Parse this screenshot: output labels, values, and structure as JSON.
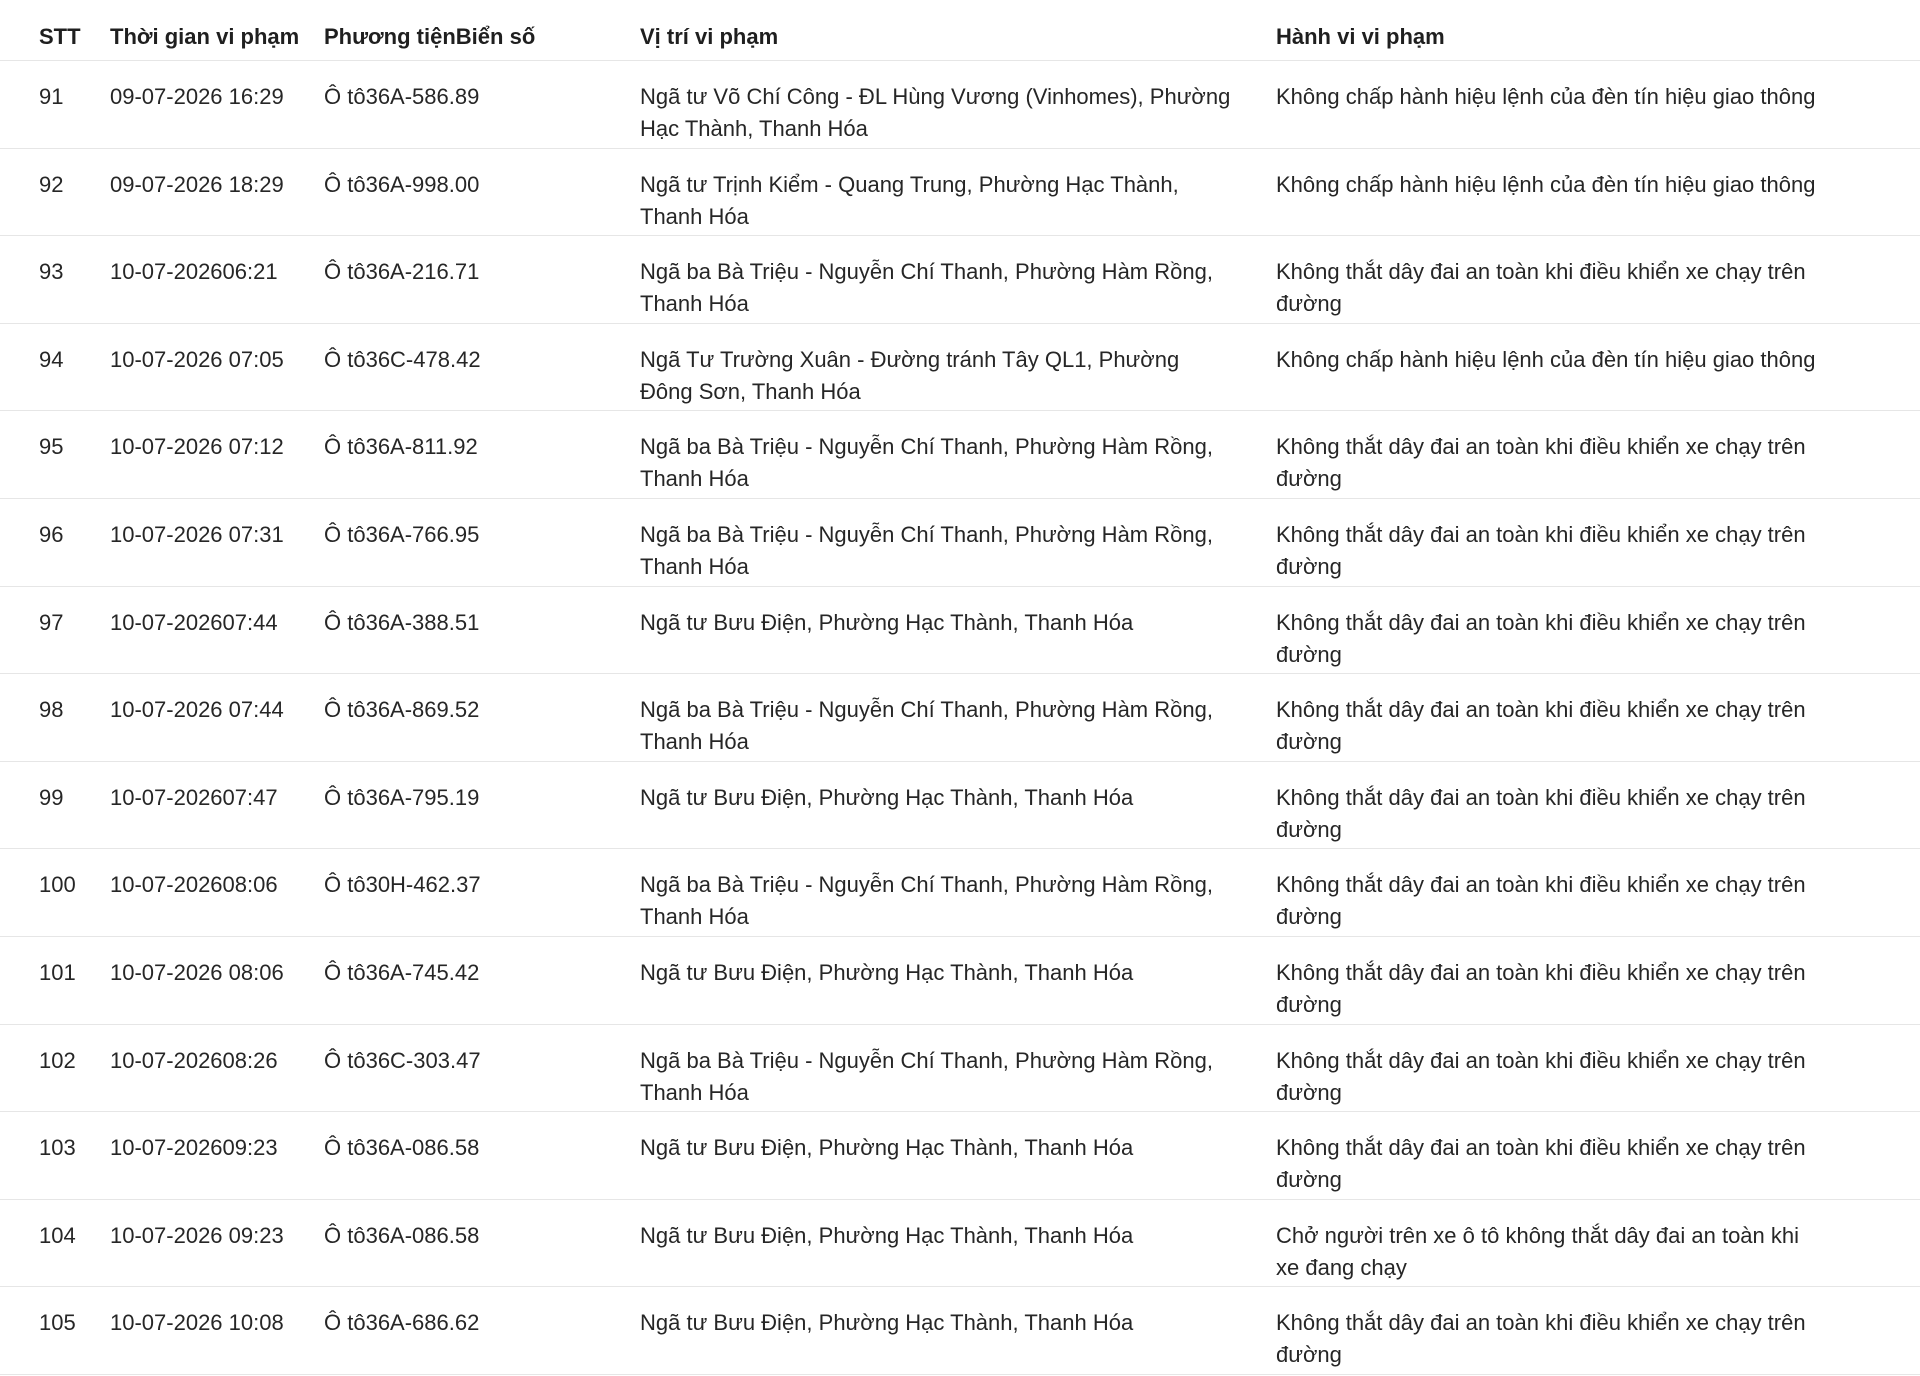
{
  "table": {
    "headers": {
      "stt": "STT",
      "time": "Thời gian vi phạm",
      "vehicle": "Phương tiện",
      "plate": "Biển số",
      "location": "Vị trí vi phạm",
      "behavior": "Hành vi vi phạm"
    },
    "rows": [
      {
        "stt": "91",
        "time": "09-07-2026 16:29",
        "vehicle": "Ô tô",
        "plate": "36A-586.89",
        "location": "Ngã tư Võ Chí Công - ĐL Hùng Vương (Vinhomes), Phường Hạc Thành, Thanh Hóa",
        "behavior": "Không chấp hành hiệu lệnh của đèn tín hiệu giao thông"
      },
      {
        "stt": "92",
        "time": "09-07-2026 18:29",
        "vehicle": "Ô tô",
        "plate": "36A-998.00",
        "location": "Ngã tư Trịnh Kiểm - Quang Trung, Phường Hạc Thành, Thanh Hóa",
        "behavior": "Không chấp hành hiệu lệnh của đèn tín hiệu giao thông"
      },
      {
        "stt": "93",
        "time": "10-07-202606:21",
        "vehicle": "Ô tô",
        "plate": "36A-216.71",
        "location": "Ngã ba Bà Triệu - Nguyễn Chí Thanh, Phường Hàm Rồng, Thanh Hóa",
        "behavior": "Không thắt dây đai an toàn khi điều khiển xe chạy trên đường"
      },
      {
        "stt": "94",
        "time": "10-07-2026 07:05",
        "vehicle": "Ô tô",
        "plate": "36C-478.42",
        "location": "Ngã Tư Trường Xuân - Đường tránh Tây QL1, Phường Đông Sơn, Thanh Hóa",
        "behavior": "Không chấp hành hiệu lệnh của đèn tín hiệu giao thông"
      },
      {
        "stt": "95",
        "time": "10-07-2026 07:12",
        "vehicle": "Ô tô",
        "plate": "36A-811.92",
        "location": "Ngã ba Bà Triệu - Nguyễn Chí Thanh, Phường Hàm Rồng, Thanh Hóa",
        "behavior": "Không thắt dây đai an toàn khi điều khiển xe chạy trên đường"
      },
      {
        "stt": "96",
        "time": "10-07-2026 07:31",
        "vehicle": "Ô tô",
        "plate": "36A-766.95",
        "location": "Ngã ba Bà Triệu - Nguyễn Chí Thanh, Phường Hàm Rồng, Thanh Hóa",
        "behavior": "Không thắt dây đai an toàn khi điều khiển xe chạy trên đường"
      },
      {
        "stt": "97",
        "time": "10-07-202607:44",
        "vehicle": "Ô tô",
        "plate": "36A-388.51",
        "location": "Ngã tư Bưu Điện, Phường Hạc Thành, Thanh Hóa",
        "behavior": "Không thắt dây đai an toàn khi điều khiển xe chạy trên đường"
      },
      {
        "stt": "98",
        "time": "10-07-2026 07:44",
        "vehicle": "Ô tô",
        "plate": "36A-869.52",
        "location": "Ngã ba Bà Triệu - Nguyễn Chí Thanh, Phường Hàm Rồng, Thanh Hóa",
        "behavior": "Không thắt dây đai an toàn khi điều khiển xe chạy trên đường"
      },
      {
        "stt": "99",
        "time": "10-07-202607:47",
        "vehicle": "Ô tô",
        "plate": "36A-795.19",
        "location": "Ngã tư Bưu Điện, Phường Hạc Thành, Thanh Hóa",
        "behavior": "Không thắt dây đai an toàn khi điều khiển xe chạy trên đường"
      },
      {
        "stt": "100",
        "time": "10-07-202608:06",
        "vehicle": "Ô tô",
        "plate": "30H-462.37",
        "location": "Ngã ba Bà Triệu - Nguyễn Chí Thanh, Phường Hàm Rồng, Thanh Hóa",
        "behavior": "Không thắt dây đai an toàn khi điều khiển xe chạy trên đường"
      },
      {
        "stt": "101",
        "time": "10-07-2026 08:06",
        "vehicle": "Ô tô",
        "plate": "36A-745.42",
        "location": "Ngã tư Bưu Điện, Phường Hạc Thành, Thanh Hóa",
        "behavior": "Không thắt dây đai an toàn khi điều khiển xe chạy trên đường"
      },
      {
        "stt": "102",
        "time": "10-07-202608:26",
        "vehicle": "Ô tô",
        "plate": "36C-303.47",
        "location": "Ngã ba Bà Triệu - Nguyễn Chí Thanh, Phường Hàm Rồng, Thanh Hóa",
        "behavior": "Không thắt dây đai an toàn khi điều khiển xe chạy trên đường"
      },
      {
        "stt": "103",
        "time": "10-07-202609:23",
        "vehicle": "Ô tô",
        "plate": "36A-086.58",
        "location": "Ngã tư Bưu Điện, Phường Hạc Thành, Thanh Hóa",
        "behavior": "Không thắt dây đai an toàn khi điều khiển xe chạy trên đường"
      },
      {
        "stt": "104",
        "time": "10-07-2026 09:23",
        "vehicle": "Ô tô",
        "plate": "36A-086.58",
        "location": "Ngã tư Bưu Điện, Phường Hạc Thành, Thanh Hóa",
        "behavior": "Chở người trên xe ô tô không thắt dây đai an toàn khi xe đang chạy"
      },
      {
        "stt": "105",
        "time": "10-07-2026 10:08",
        "vehicle": "Ô tô",
        "plate": "36A-686.62",
        "location": "Ngã tư Bưu Điện, Phường Hạc Thành, Thanh Hóa",
        "behavior": "Không thắt dây đai an toàn khi điều khiển xe chạy trên đường"
      }
    ]
  }
}
